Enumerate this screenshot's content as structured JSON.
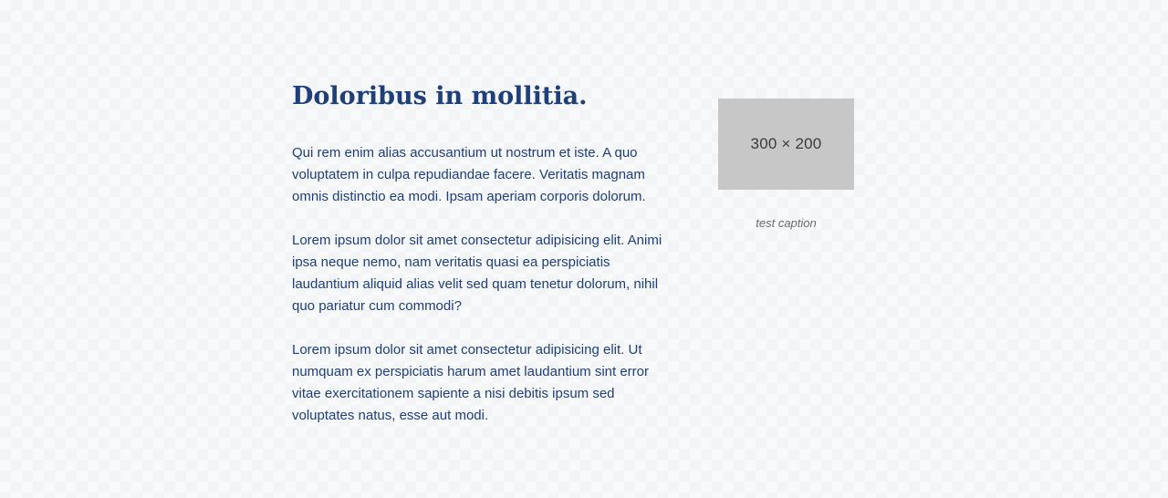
{
  "article": {
    "title": "Doloribus in mollitia.",
    "paragraphs": [
      "Qui rem enim alias accusantium ut nostrum et iste. A quo voluptatem in culpa repudiandae facere. Veritatis magnam omnis distinctio ea modi. Ipsam aperiam corporis dolorum.",
      "Lorem ipsum dolor sit amet consectetur adipisicing elit. Animi ipsa neque nemo, nam veritatis quasi ea perspiciatis laudantium aliquid alias velit sed quam tenetur dolorum, nihil quo pariatur cum commodi?",
      "Lorem ipsum dolor sit amet consectetur adipisicing elit. Ut numquam ex perspiciatis harum amet laudantium sint error vitae exercitationem sapiente a nisi debitis ipsum sed voluptates natus, esse aut modi."
    ]
  },
  "figure": {
    "placeholder_text": "300 × 200",
    "caption": "test caption"
  },
  "colors": {
    "text": "#1e3f7a",
    "placeholder_bg": "#c7c7c7",
    "caption": "#6b6b6b"
  }
}
